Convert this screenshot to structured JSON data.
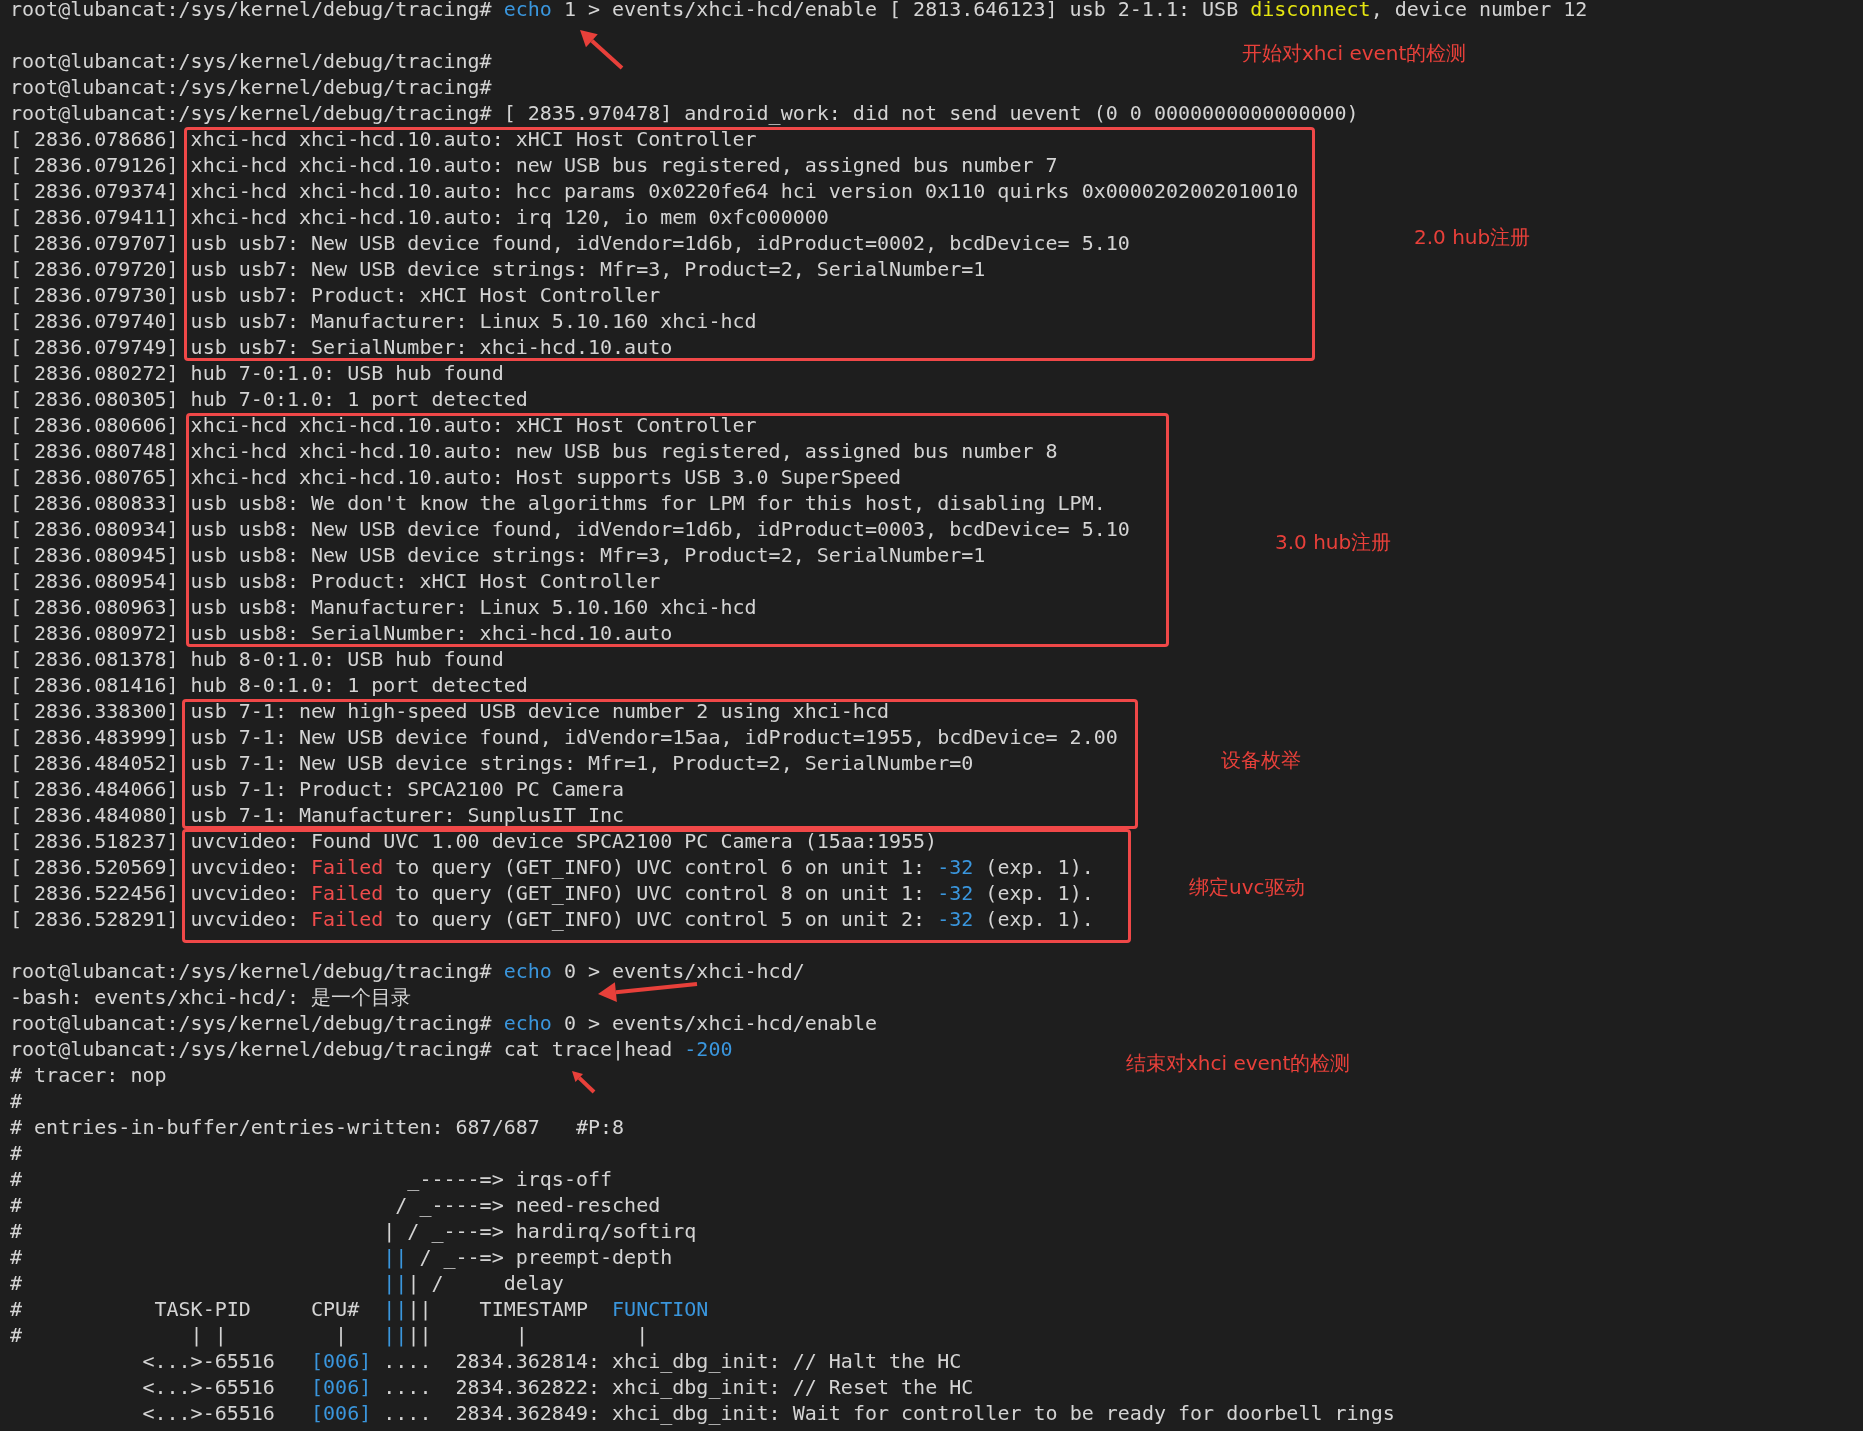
{
  "terminal": {
    "lines": [
      [
        {
          "text": "root@lubancat:/sys/kernel/debug/tracing# "
        },
        {
          "text": "echo",
          "kind": "cmd"
        },
        {
          "text": " 1 > events/xhci-hcd/enable [ 2813.646123] usb 2-1.1: USB "
        },
        {
          "text": "disconnect",
          "kind": "warn"
        },
        {
          "text": ", device number 12"
        }
      ],
      {
        "kind": "blank"
      },
      [
        {
          "text": "root@lubancat:/sys/kernel/debug/tracing#"
        }
      ],
      [
        {
          "text": "root@lubancat:/sys/kernel/debug/tracing#"
        }
      ],
      [
        {
          "text": "root@lubancat:/sys/kernel/debug/tracing# [ 2835.970478] android_work: did not send uevent (0 0 0000000000000000)"
        }
      ],
      [
        {
          "text": "[ 2836.078686] xhci-hcd xhci-hcd.10.auto: xHCI Host Controller"
        }
      ],
      [
        {
          "text": "[ 2836.079126] xhci-hcd xhci-hcd.10.auto: new USB bus registered, assigned bus number 7"
        }
      ],
      [
        {
          "text": "[ 2836.079374] xhci-hcd xhci-hcd.10.auto: hcc params 0x0220fe64 hci version 0x110 quirks 0x0000202002010010"
        }
      ],
      [
        {
          "text": "[ 2836.079411] xhci-hcd xhci-hcd.10.auto: irq 120, io mem 0xfc000000"
        }
      ],
      [
        {
          "text": "[ 2836.079707] usb usb7: New USB device found, idVendor=1d6b, idProduct=0002, bcdDevice= 5.10"
        }
      ],
      [
        {
          "text": "[ 2836.079720] usb usb7: New USB device strings: Mfr=3, Product=2, SerialNumber=1"
        }
      ],
      [
        {
          "text": "[ 2836.079730] usb usb7: Product: xHCI Host Controller"
        }
      ],
      [
        {
          "text": "[ 2836.079740] usb usb7: Manufacturer: Linux 5.10.160 xhci-hcd"
        }
      ],
      [
        {
          "text": "[ 2836.079749] usb usb7: SerialNumber: xhci-hcd.10.auto"
        }
      ],
      [
        {
          "text": "[ 2836.080272] hub 7-0:1.0: USB hub found"
        }
      ],
      [
        {
          "text": "[ 2836.080305] hub 7-0:1.0: 1 port detected"
        }
      ],
      [
        {
          "text": "[ 2836.080606] xhci-hcd xhci-hcd.10.auto: xHCI Host Controller"
        }
      ],
      [
        {
          "text": "[ 2836.080748] xhci-hcd xhci-hcd.10.auto: new USB bus registered, assigned bus number 8"
        }
      ],
      [
        {
          "text": "[ 2836.080765] xhci-hcd xhci-hcd.10.auto: Host supports USB 3.0 SuperSpeed"
        }
      ],
      [
        {
          "text": "[ 2836.080833] usb usb8: We don't know the algorithms for LPM for this host, disabling LPM."
        }
      ],
      [
        {
          "text": "[ 2836.080934] usb usb8: New USB device found, idVendor=1d6b, idProduct=0003, bcdDevice= 5.10"
        }
      ],
      [
        {
          "text": "[ 2836.080945] usb usb8: New USB device strings: Mfr=3, Product=2, SerialNumber=1"
        }
      ],
      [
        {
          "text": "[ 2836.080954] usb usb8: Product: xHCI Host Controller"
        }
      ],
      [
        {
          "text": "[ 2836.080963] usb usb8: Manufacturer: Linux 5.10.160 xhci-hcd"
        }
      ],
      [
        {
          "text": "[ 2836.080972] usb usb8: SerialNumber: xhci-hcd.10.auto"
        }
      ],
      [
        {
          "text": "[ 2836.081378] hub 8-0:1.0: USB hub found"
        }
      ],
      [
        {
          "text": "[ 2836.081416] hub 8-0:1.0: 1 port detected"
        }
      ],
      [
        {
          "text": "[ 2836.338300] usb 7-1: new high-speed USB device number 2 using xhci-hcd"
        }
      ],
      [
        {
          "text": "[ 2836.483999] usb 7-1: New USB device found, idVendor=15aa, idProduct=1955, bcdDevice= 2.00"
        }
      ],
      [
        {
          "text": "[ 2836.484052] usb 7-1: New USB device strings: Mfr=1, Product=2, SerialNumber=0"
        }
      ],
      [
        {
          "text": "[ 2836.484066] usb 7-1: Product: SPCA2100 PC Camera"
        }
      ],
      [
        {
          "text": "[ 2836.484080] usb 7-1: Manufacturer: SunplusIT Inc"
        }
      ],
      [
        {
          "text": "[ 2836.518237] uvcvideo: Found UVC 1.00 device SPCA2100 PC Camera (15aa:1955)"
        }
      ],
      [
        {
          "text": "[ 2836.520569] uvcvideo: "
        },
        {
          "text": "Failed",
          "kind": "err"
        },
        {
          "text": " to query (GET_INFO) UVC control 6 on unit 1: "
        },
        {
          "text": "-32",
          "kind": "num"
        },
        {
          "text": " (exp. 1)."
        }
      ],
      [
        {
          "text": "[ 2836.522456] uvcvideo: "
        },
        {
          "text": "Failed",
          "kind": "err"
        },
        {
          "text": " to query (GET_INFO) UVC control 8 on unit 1: "
        },
        {
          "text": "-32",
          "kind": "num"
        },
        {
          "text": " (exp. 1)."
        }
      ],
      [
        {
          "text": "[ 2836.528291] uvcvideo: "
        },
        {
          "text": "Failed",
          "kind": "err"
        },
        {
          "text": " to query (GET_INFO) UVC control 5 on unit 2: "
        },
        {
          "text": "-32",
          "kind": "num"
        },
        {
          "text": " (exp. 1)."
        }
      ],
      {
        "kind": "blank"
      },
      [
        {
          "text": "root@lubancat:/sys/kernel/debug/tracing# "
        },
        {
          "text": "echo",
          "kind": "cmd"
        },
        {
          "text": " 0 > events/xhci-hcd/"
        }
      ],
      [
        {
          "text": "-bash: events/xhci-hcd/: 是一个目录"
        }
      ],
      [
        {
          "text": "root@lubancat:/sys/kernel/debug/tracing# "
        },
        {
          "text": "echo",
          "kind": "cmd"
        },
        {
          "text": " 0 > events/xhci-hcd/enable"
        }
      ],
      [
        {
          "text": "root@lubancat:/sys/kernel/debug/tracing# cat trace|head "
        },
        {
          "text": "-200",
          "kind": "num"
        }
      ],
      [
        {
          "text": "# tracer: nop"
        }
      ],
      [
        {
          "text": "#"
        }
      ],
      [
        {
          "text": "# entries-in-buffer/entries-written: 687/687   #P:8"
        }
      ],
      [
        {
          "text": "#"
        }
      ],
      [
        {
          "text": "#                                _-----=> irqs-off"
        }
      ],
      [
        {
          "text": "#                               / _----=> need-resched"
        }
      ],
      [
        {
          "text": "#                              | / _---=> hardirq/softirq"
        }
      ],
      [
        {
          "text": "#                              "
        },
        {
          "text": "||",
          "kind": "num"
        },
        {
          "text": " / _--=> preempt-depth"
        }
      ],
      [
        {
          "text": "#                              "
        },
        {
          "text": "||",
          "kind": "num"
        },
        {
          "text": "| /     delay"
        }
      ],
      [
        {
          "text": "#           TASK-PID     CPU#  "
        },
        {
          "text": "||",
          "kind": "num"
        },
        {
          "text": "||    TIMESTAMP  "
        },
        {
          "text": "FUNCTION",
          "kind": "num"
        }
      ],
      [
        {
          "text": "#              | |         |   "
        },
        {
          "text": "||",
          "kind": "num"
        },
        {
          "text": "||       |         |"
        }
      ],
      [
        {
          "text": "           <...>-65516   "
        },
        {
          "text": "[006]",
          "kind": "num"
        },
        {
          "text": " ....  2834.362814: xhci_dbg_init: // Halt the HC"
        }
      ],
      [
        {
          "text": "           <...>-65516   "
        },
        {
          "text": "[006]",
          "kind": "num"
        },
        {
          "text": " ....  2834.362822: xhci_dbg_init: // Reset the HC"
        }
      ],
      [
        {
          "text": "           <...>-65516   "
        },
        {
          "text": "[006]",
          "kind": "num"
        },
        {
          "text": " ....  2834.362849: xhci_dbg_init: Wait for controller to be ready for doorbell rings"
        }
      ]
    ]
  },
  "annotations": [
    {
      "label": "开始对xhci event的检测"
    },
    {
      "label": "2.0 hub注册"
    },
    {
      "label": "3.0 hub注册"
    },
    {
      "label": "设备枚举"
    },
    {
      "label": "绑定uvc驱动"
    },
    {
      "label": "结束对xhci event的检测"
    }
  ]
}
